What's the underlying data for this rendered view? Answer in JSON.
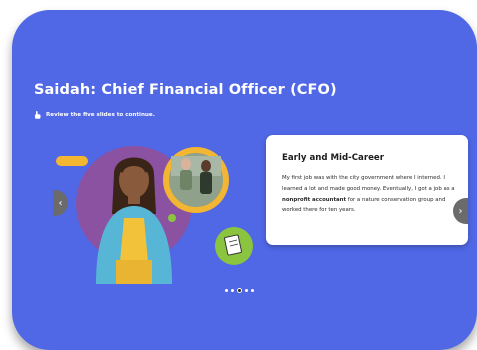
{
  "lesson": {
    "title": "Saidah: Chief Financial Officer (CFO)",
    "instruction": "Review the five slides to continue."
  },
  "icons": {
    "instruction": "pointing-hand-icon",
    "prev": "chevron-left-icon",
    "next": "chevron-right-icon",
    "document": "document-icon"
  },
  "slide": {
    "heading": "Early and Mid-Career",
    "text_before": "My first job was with the city government where I interned. I learned a lot and made good money. Eventually, I got a job as a ",
    "text_bold": "nonprofit accountant",
    "text_after": " for a nature conservation group and worked there for ten years."
  },
  "carousel": {
    "total": 5,
    "current": 3,
    "prev_glyph": "‹",
    "next_glyph": "›"
  },
  "colors": {
    "background": "#5067e6",
    "accent_yellow": "#f2b632",
    "accent_green": "#8bc53f",
    "accent_purple": "#8b52a1",
    "nav_gray": "#6b6b6b"
  }
}
